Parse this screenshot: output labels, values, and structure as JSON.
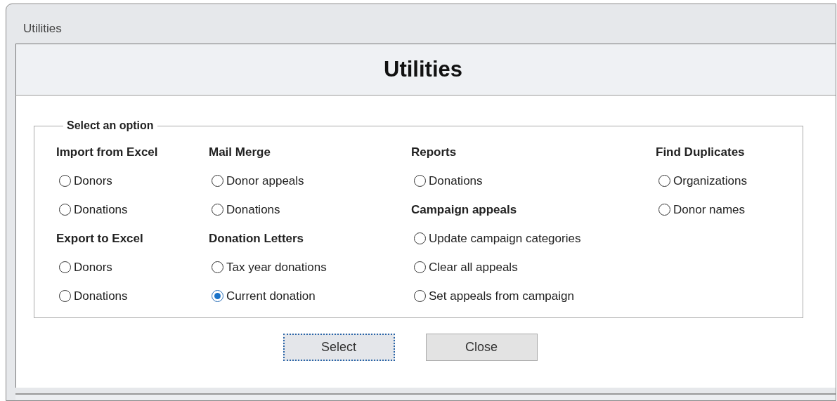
{
  "window": {
    "title": "Utilities"
  },
  "header": {
    "title": "Utilities"
  },
  "group": {
    "legend": "Select an option",
    "columns": [
      {
        "sections": [
          {
            "heading": "Import from Excel",
            "options": [
              {
                "label": "Donors",
                "selected": false
              },
              {
                "label": "Donations",
                "selected": false
              }
            ]
          },
          {
            "heading": "Export to Excel",
            "options": [
              {
                "label": "Donors",
                "selected": false
              },
              {
                "label": "Donations",
                "selected": false
              }
            ]
          }
        ]
      },
      {
        "sections": [
          {
            "heading": "Mail Merge",
            "options": [
              {
                "label": "Donor appeals",
                "selected": false
              },
              {
                "label": "Donations",
                "selected": false
              }
            ]
          },
          {
            "heading": "Donation Letters",
            "options": [
              {
                "label": "Tax year donations",
                "selected": false
              },
              {
                "label": "Current donation",
                "selected": true
              }
            ]
          }
        ]
      },
      {
        "sections": [
          {
            "heading": "Reports",
            "options": [
              {
                "label": "Donations",
                "selected": false
              }
            ]
          },
          {
            "heading": "Campaign appeals",
            "options": [
              {
                "label": "Update campaign categories",
                "selected": false
              },
              {
                "label": "Clear all appeals",
                "selected": false
              },
              {
                "label": "Set appeals from campaign",
                "selected": false
              }
            ]
          }
        ]
      },
      {
        "sections": [
          {
            "heading": "Find Duplicates",
            "options": [
              {
                "label": "Organizations",
                "selected": false
              },
              {
                "label": "Donor names",
                "selected": false
              }
            ]
          }
        ]
      }
    ]
  },
  "buttons": [
    {
      "label": "Select",
      "focused": true
    },
    {
      "label": "Close",
      "focused": false
    }
  ]
}
